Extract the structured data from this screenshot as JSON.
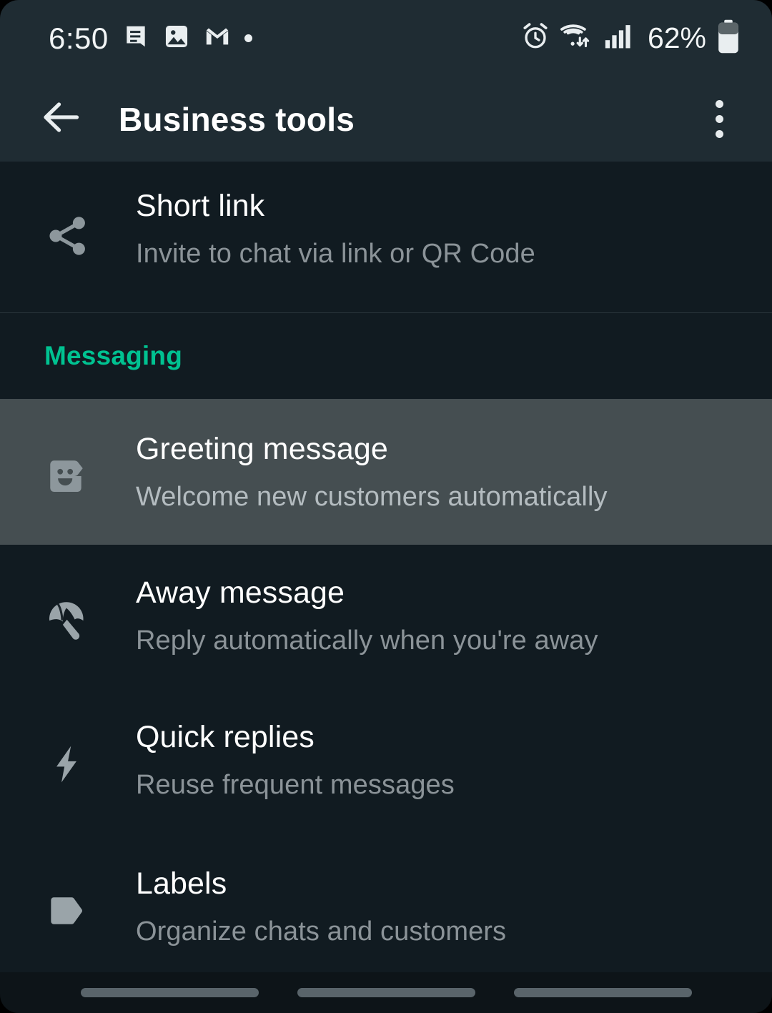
{
  "status_bar": {
    "time": "6:50",
    "left_icons": [
      "message-icon",
      "image-icon",
      "gmail-icon",
      "dot-indicator"
    ],
    "right_icons": [
      "alarm-icon",
      "wifi-icon",
      "signal-icon"
    ],
    "battery_percent": "62%",
    "battery_level": 62
  },
  "app_bar": {
    "back_icon": "back-arrow-icon",
    "title": "Business tools",
    "overflow_icon": "more-vertical-icon"
  },
  "list": {
    "top_items": [
      {
        "icon": "share-icon",
        "title": "Short link",
        "subtitle": "Invite to chat via link or QR Code",
        "selected": false
      }
    ],
    "section": {
      "label": "Messaging",
      "color": "#00c291"
    },
    "messaging_items": [
      {
        "icon": "chat-smiley-icon",
        "title": "Greeting message",
        "subtitle": "Welcome new customers automatically",
        "selected": true
      },
      {
        "icon": "umbrella-icon",
        "title": "Away message",
        "subtitle": "Reply automatically when you're away",
        "selected": false
      },
      {
        "icon": "lightning-bolt-icon",
        "title": "Quick replies",
        "subtitle": "Reuse frequent messages",
        "selected": false
      },
      {
        "icon": "tag-icon",
        "title": "Labels",
        "subtitle": "Organize chats and customers",
        "selected": false
      }
    ]
  },
  "nav_bar": {
    "pills": [
      "nav-pill-left",
      "nav-pill-center",
      "nav-pill-right"
    ]
  },
  "colors": {
    "app_bar_bg": "#1f2c33",
    "list_bg": "#111b21",
    "selected_row_bg": "#454e51",
    "accent": "#00c291",
    "title_text": "#ffffff",
    "subtitle_text": "#8b9398",
    "icon_tint": "#8d979c"
  }
}
